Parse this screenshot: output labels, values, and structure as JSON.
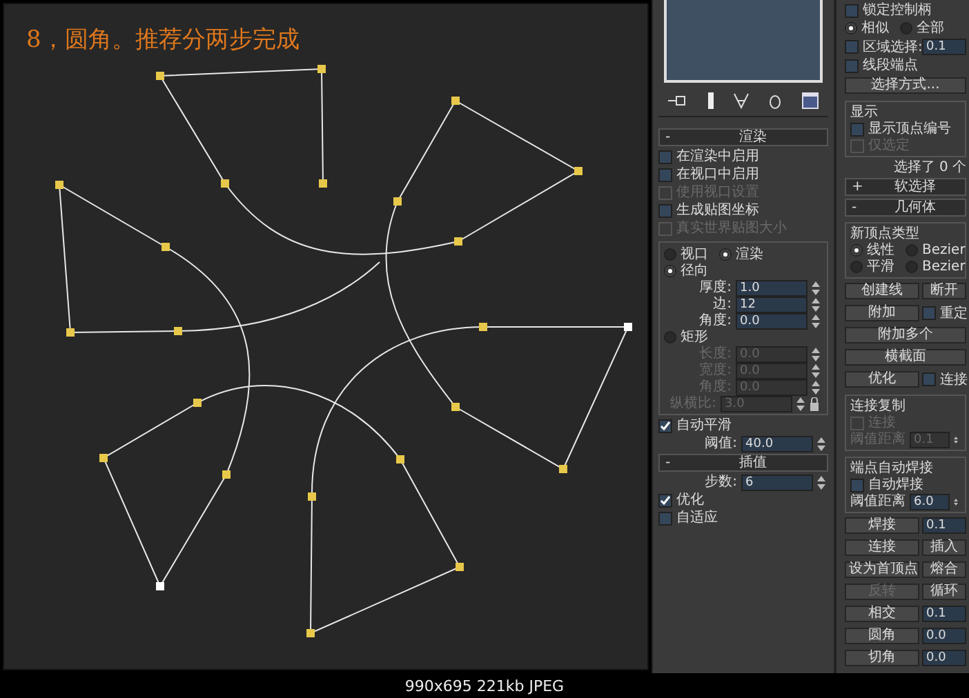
{
  "annotation": "8，圆角。推荐分两步完成",
  "middle_panel": [
    {
      "kind": "header",
      "sign": "-",
      "label": "渲染"
    },
    {
      "kind": "check",
      "label": "在渲染中启用",
      "checked": false,
      "disabled": false
    },
    {
      "kind": "check",
      "label": "在视口中启用",
      "checked": false,
      "disabled": false
    },
    {
      "kind": "check",
      "label": "使用视口设置",
      "checked": false,
      "disabled": true
    },
    {
      "kind": "check",
      "label": "生成贴图坐标",
      "checked": false,
      "disabled": false
    },
    {
      "kind": "check",
      "label": "真实世界贴图大小",
      "checked": false,
      "disabled": true
    },
    {
      "kind": "group",
      "items": [
        {
          "kind": "radios",
          "options": [
            {
              "label": "视口",
              "selected": false
            },
            {
              "label": "渲染",
              "selected": true
            }
          ]
        },
        {
          "kind": "radio",
          "label": "径向",
          "selected": true
        },
        {
          "kind": "spinner",
          "label": "厚度:",
          "value": "1.0",
          "disabled": false
        },
        {
          "kind": "spinner",
          "label": "边:",
          "value": "12",
          "disabled": false
        },
        {
          "kind": "spinner",
          "label": "角度:",
          "value": "0.0",
          "disabled": false
        },
        {
          "kind": "radio",
          "label": "矩形",
          "selected": false
        },
        {
          "kind": "spinner",
          "label": "长度:",
          "value": "0.0",
          "disabled": true
        },
        {
          "kind": "spinner",
          "label": "宽度:",
          "value": "0.0",
          "disabled": true
        },
        {
          "kind": "spinner",
          "label": "角度:",
          "value": "0.0",
          "disabled": true
        },
        {
          "kind": "spinner",
          "label": "纵横比:",
          "value": "3.0",
          "disabled": true,
          "lock": true
        }
      ]
    },
    {
      "kind": "check",
      "label": "自动平滑",
      "checked": true,
      "disabled": false
    },
    {
      "kind": "spinner",
      "label": "阈值:",
      "value": "40.0",
      "disabled": false
    },
    {
      "kind": "header",
      "sign": "-",
      "label": "插值"
    },
    {
      "kind": "spinner",
      "label": "步数:",
      "value": "6",
      "disabled": false
    },
    {
      "kind": "check",
      "label": "优化",
      "checked": true,
      "disabled": false
    },
    {
      "kind": "check",
      "label": "自适应",
      "checked": false,
      "disabled": false
    }
  ],
  "right_panel": [
    {
      "kind": "check",
      "label": "锁定控制柄",
      "checked": false,
      "disabled": false
    },
    {
      "kind": "radios",
      "options": [
        {
          "label": "相似",
          "selected": true
        },
        {
          "label": "全部",
          "selected": false
        }
      ]
    },
    {
      "kind": "pair",
      "items": [
        {
          "kind": "check",
          "label": "区域选择:",
          "checked": false,
          "disabled": false
        },
        {
          "kind": "value",
          "value": "0.1",
          "disabled": false
        }
      ]
    },
    {
      "kind": "check",
      "label": "线段端点",
      "checked": false,
      "disabled": false
    },
    {
      "kind": "button",
      "label": "选择方式...",
      "disabled": false
    },
    {
      "kind": "group",
      "title": "显示",
      "items": [
        {
          "kind": "check",
          "label": "显示顶点编号",
          "checked": false,
          "disabled": false
        },
        {
          "kind": "check",
          "label": "仅选定",
          "checked": false,
          "disabled": true
        }
      ]
    },
    {
      "kind": "text",
      "label": "选择了 0 个"
    },
    {
      "kind": "header",
      "sign": "+",
      "label": "软选择"
    },
    {
      "kind": "header",
      "sign": "-",
      "label": "几何体"
    },
    {
      "kind": "group",
      "title": "新顶点类型",
      "items": [
        {
          "kind": "radios",
          "options": [
            {
              "label": "线性",
              "selected": true
            },
            {
              "label": "Bezier",
              "selected": false
            }
          ]
        },
        {
          "kind": "radios",
          "options": [
            {
              "label": "平滑",
              "selected": false
            },
            {
              "label": "Bezier",
              "selected": false
            }
          ]
        }
      ]
    },
    {
      "kind": "pair",
      "items": [
        {
          "kind": "button",
          "label": "创建线",
          "disabled": false
        },
        {
          "kind": "button",
          "label": "断开",
          "disabled": false
        }
      ]
    },
    {
      "kind": "pair",
      "items": [
        {
          "kind": "button",
          "label": "附加",
          "disabled": false
        },
        {
          "kind": "check",
          "label": "重定",
          "checked": false,
          "disabled": false
        }
      ]
    },
    {
      "kind": "button",
      "label": "附加多个",
      "disabled": false
    },
    {
      "kind": "button",
      "label": "横截面",
      "disabled": false
    },
    {
      "kind": "pair",
      "items": [
        {
          "kind": "button",
          "label": "优化",
          "disabled": false
        },
        {
          "kind": "check",
          "label": "连接",
          "checked": false,
          "disabled": false
        }
      ]
    },
    {
      "kind": "group",
      "title": "连接复制",
      "items": [
        {
          "kind": "check",
          "label": "连接",
          "checked": false,
          "disabled": true
        },
        {
          "kind": "spinner",
          "label": "阈值距离",
          "value": "0.1",
          "disabled": true
        }
      ]
    },
    {
      "kind": "group",
      "title": "端点自动焊接",
      "items": [
        {
          "kind": "check",
          "label": "自动焊接",
          "checked": false,
          "disabled": false
        },
        {
          "kind": "spinner",
          "label": "阈值距离",
          "value": "6.0",
          "disabled": false
        }
      ]
    },
    {
      "kind": "pair",
      "items": [
        {
          "kind": "button",
          "label": "焊接",
          "disabled": false
        },
        {
          "kind": "value",
          "value": "0.1",
          "disabled": false
        }
      ]
    },
    {
      "kind": "pair",
      "items": [
        {
          "kind": "button",
          "label": "连接",
          "disabled": false
        },
        {
          "kind": "button",
          "label": "插入",
          "disabled": false
        }
      ]
    },
    {
      "kind": "pair",
      "items": [
        {
          "kind": "button",
          "label": "设为首顶点",
          "disabled": false
        },
        {
          "kind": "button",
          "label": "熔合",
          "disabled": false
        }
      ]
    },
    {
      "kind": "pair",
      "items": [
        {
          "kind": "button",
          "label": "反转",
          "disabled": true
        },
        {
          "kind": "button",
          "label": "循环",
          "disabled": false
        }
      ]
    },
    {
      "kind": "pair",
      "items": [
        {
          "kind": "button",
          "label": "相交",
          "disabled": false
        },
        {
          "kind": "value",
          "value": "0.1",
          "disabled": false
        }
      ]
    },
    {
      "kind": "pair",
      "items": [
        {
          "kind": "button",
          "label": "圆角",
          "disabled": false
        },
        {
          "kind": "value",
          "value": "0.0",
          "disabled": false
        }
      ]
    },
    {
      "kind": "pair",
      "items": [
        {
          "kind": "button",
          "label": "切角",
          "disabled": false
        },
        {
          "kind": "value",
          "value": "0.0",
          "disabled": false
        }
      ]
    }
  ],
  "image_info": "990x695 221kb JPEG"
}
